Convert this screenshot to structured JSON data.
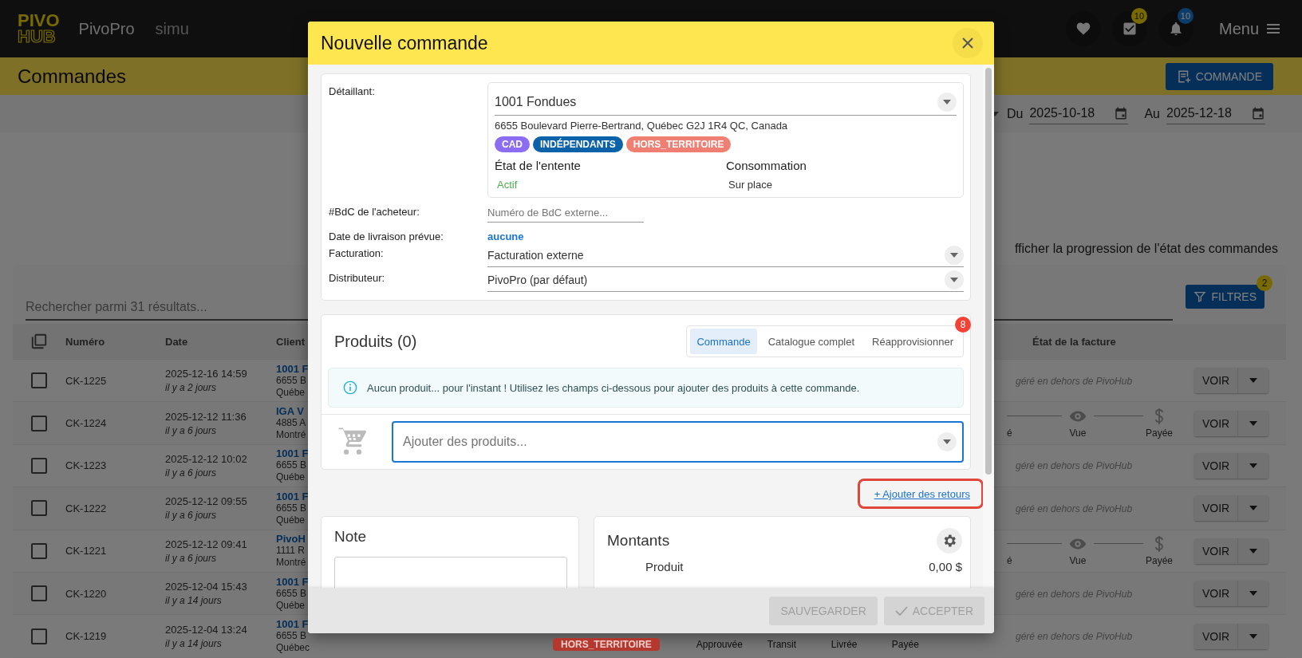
{
  "app": {
    "logo_top": "PIVO",
    "logo_bottom": "HUB",
    "name": "PivoPro",
    "environment": "simu",
    "tasks_badge": "10",
    "notifications_badge": "10",
    "menu_label": "Menu"
  },
  "page": {
    "title": "Commandes",
    "new_button": "COMMANDE",
    "date_from_label": "Du",
    "date_from": "2025-10-18",
    "date_to_label": "Au",
    "date_to": "2025-12-18",
    "progress_toggle": "fficher la progression de l'état des commandes"
  },
  "table": {
    "search_placeholder": "Rechercher parmi 31 résultats...",
    "filters_button": "FILTRES",
    "filters_badge": "2",
    "columns": [
      "Numéro",
      "Date",
      "Client",
      "État de la facture"
    ],
    "rows": [
      {
        "number": "CK-1225",
        "date": "2025-12-16 14:59",
        "ago": "il y a 2 jours",
        "client": [
          "1001 F",
          "6655 B",
          "Québe"
        ],
        "invoice": {
          "kind": "note",
          "text": "géré en dehors de PivoHub"
        },
        "action": "VOIR",
        "checked": false
      },
      {
        "number": "CK-1224",
        "date": "2025-12-12 11:36",
        "ago": "il y a 6 jours",
        "client": [
          "IGA V",
          "4885 A",
          "Montré"
        ],
        "invoice": {
          "kind": "progress",
          "steps": [
            "é",
            "Vue",
            "Payée"
          ]
        },
        "action": "VOIR",
        "checked": false
      },
      {
        "number": "CK-1223",
        "date": "2025-12-12 10:02",
        "ago": "il y a 6 jours",
        "client": [
          "1001 F",
          "6655 B",
          "Québe"
        ],
        "invoice": {
          "kind": "note",
          "text": "géré en dehors de PivoHub"
        },
        "action": "VOIR",
        "checked": false
      },
      {
        "number": "CK-1222",
        "date": "2025-12-12 09:55",
        "ago": "il y a 6 jours",
        "client": [
          "1001 F",
          "6655 B",
          "Québe"
        ],
        "invoice": {
          "kind": "note",
          "text": "géré en dehors de PivoHub"
        },
        "action": "VOIR",
        "checked": false
      },
      {
        "number": "CK-1221",
        "date": "2025-12-12 09:41",
        "ago": "il y a 6 jours",
        "client": [
          "PivoH",
          "1111 R",
          "Montré"
        ],
        "invoice": {
          "kind": "progress",
          "steps": [
            "é",
            "Vue",
            "Payée"
          ]
        },
        "action": "VOIR",
        "checked": false
      },
      {
        "number": "CK-1220",
        "date": "2025-12-04 15:43",
        "ago": "il y a 14 jours",
        "client": [
          "1001 F",
          "6655 B",
          "Québe"
        ],
        "invoice": {
          "kind": "note",
          "text": "géré en dehors de PivoHub"
        },
        "action": "VOIR",
        "checked": false
      },
      {
        "number": "CK-1219",
        "date": "2025-12-04 13:24",
        "ago": "il y a 14 jours",
        "client": [
          "1001 F",
          "6655 B",
          "Québec"
        ],
        "tags": [
          {
            "text": "HORS_TERRITOIRE",
            "color": "#b5382f"
          }
        ],
        "order_steps": [
          "Approuvée",
          "Transit",
          "Livrée",
          "Payée"
        ],
        "invoice": {
          "kind": "note",
          "text": "géré en dehors de PivoHub"
        },
        "action": "VOIR",
        "checked": false
      }
    ]
  },
  "modal": {
    "title": "Nouvelle commande",
    "retailer": {
      "label": "Détaillant:",
      "name": "1001 Fondues",
      "address": "6655 Boulevard Pierre-Bertrand, Québec G2J 1R4 QC, Canada",
      "tags": [
        {
          "text": "CAD",
          "color": "#8c6cf2"
        },
        {
          "text": "INDÉPENDANTS",
          "color": "#0b62a8"
        },
        {
          "text": "HORS_TERRITOIRE",
          "color": "#f07f73"
        }
      ],
      "agreement_label": "État de l'entente",
      "agreement_value": "Actif",
      "consumption_label": "Consommation",
      "consumption_value": "Sur place"
    },
    "po": {
      "label": "#BdC de l'acheteur:",
      "placeholder": "Numéro de BdC externe..."
    },
    "delivery": {
      "label": "Date de livraison prévue:",
      "value": "aucune"
    },
    "billing": {
      "label": "Facturation:",
      "value": "Facturation externe"
    },
    "distributor": {
      "label": "Distributeur:",
      "value": "PivoPro (par défaut)"
    },
    "products": {
      "title": "Produits (0)",
      "tabs": [
        {
          "label": "Commande",
          "selected": true
        },
        {
          "label": "Catalogue complet",
          "selected": false
        },
        {
          "label": "Réapprovisionner",
          "selected": false
        }
      ],
      "tabs_badge": "8",
      "info": "Aucun produit... pour l'instant ! Utilisez les champs ci-dessous pour ajouter des produits à cette commande.",
      "add_placeholder": "Ajouter des produits..."
    },
    "returns_link": "+ Ajouter des retours",
    "note": {
      "title": "Note"
    },
    "amounts": {
      "title": "Montants",
      "lines": [
        {
          "label": "Produit",
          "value": "0,00 $"
        }
      ]
    },
    "buttons": [
      {
        "kind": "save",
        "label": "SAUVEGARDER",
        "disabled": true
      },
      {
        "kind": "accept",
        "label": "ACCEPTER",
        "disabled": true
      }
    ]
  }
}
